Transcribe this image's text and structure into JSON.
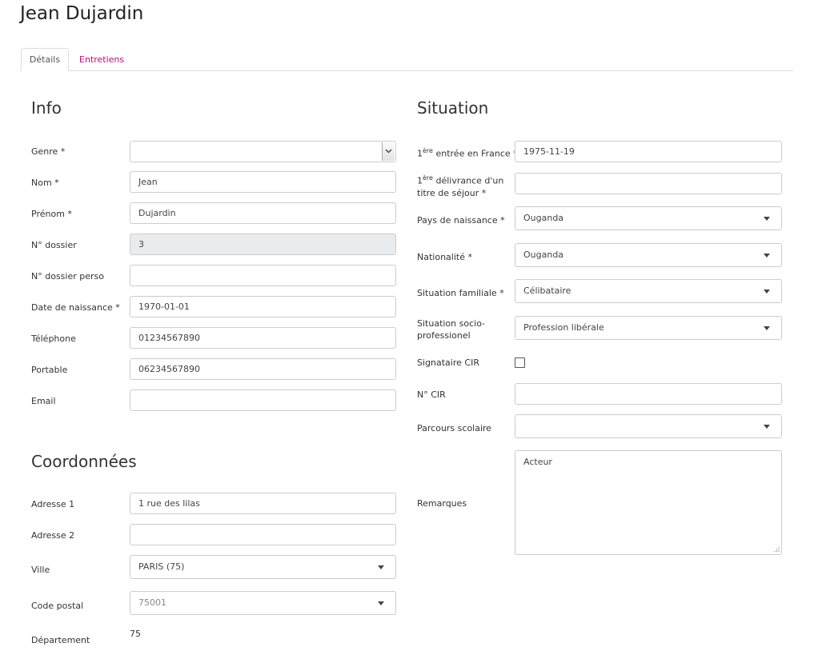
{
  "page": {
    "title": "Jean Dujardin"
  },
  "tabs": [
    {
      "label": "Détails",
      "active": true
    },
    {
      "label": "Entretiens",
      "active": false
    }
  ],
  "colors": {
    "accent": "#b0127a",
    "border": "#cccccc",
    "disabled_bg": "#e9ecef"
  },
  "info": {
    "title": "Info",
    "genre": {
      "label": "Genre *",
      "value": ""
    },
    "nom": {
      "label": "Nom *",
      "value": "Jean"
    },
    "prenom": {
      "label": "Prénom *",
      "value": "Dujardin"
    },
    "dossier": {
      "label": "N° dossier",
      "value": "3"
    },
    "dossier_perso": {
      "label": "N° dossier perso",
      "value": ""
    },
    "naissance": {
      "label": "Date de naissance *",
      "value": "1970-01-01"
    },
    "telephone": {
      "label": "Téléphone",
      "value": "01234567890"
    },
    "portable": {
      "label": "Portable",
      "value": "06234567890"
    },
    "email": {
      "label": "Email",
      "value": ""
    }
  },
  "coordonnees": {
    "title": "Coordonnées",
    "adresse1": {
      "label": "Adresse 1",
      "value": "1 rue des lilas"
    },
    "adresse2": {
      "label": "Adresse 2",
      "value": ""
    },
    "ville": {
      "label": "Ville",
      "value": "PARIS (75)"
    },
    "code_postal": {
      "label": "Code postal",
      "value": "75001"
    },
    "departement": {
      "label": "Département",
      "value": "75"
    }
  },
  "situation": {
    "title": "Situation",
    "entree": {
      "label_sup": "ère",
      "label_pre": "1",
      "label_post": " entrée en France *",
      "value": "1975-11-19"
    },
    "delivrance": {
      "label_sup": "ère",
      "label_pre": "1",
      "label_line1": " délivrance d'un",
      "label_line2": "titre de séjour *",
      "value": ""
    },
    "pays": {
      "label": "Pays de naissance *",
      "value": "Ouganda"
    },
    "nationalite": {
      "label": "Nationalité *",
      "value": "Ouganda"
    },
    "familiale": {
      "label": "Situation familiale *",
      "value": "Célibataire"
    },
    "socio": {
      "label_line1": "Situation socio-",
      "label_line2": "professionel",
      "value": "Profession libérale"
    },
    "signataire": {
      "label": "Signataire CIR",
      "checked": false
    },
    "cir": {
      "label": "N° CIR",
      "value": ""
    },
    "parcours": {
      "label": "Parcours scolaire",
      "value": ""
    },
    "remarques": {
      "label": "Remarques",
      "value": "Acteur"
    }
  }
}
